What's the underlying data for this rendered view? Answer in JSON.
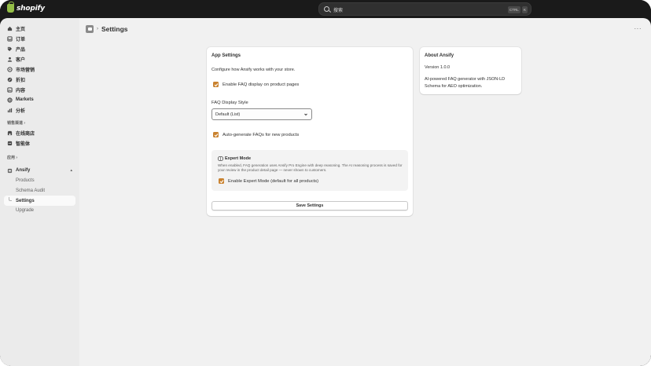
{
  "topbar": {
    "brand": "shopify",
    "search_placeholder": "搜索",
    "shortcut_ctrl": "CTRL",
    "shortcut_k": "K"
  },
  "sidebar": {
    "items": [
      {
        "label": "主页",
        "icon": "home-icon"
      },
      {
        "label": "订单",
        "icon": "inbox-icon"
      },
      {
        "label": "产品",
        "icon": "tag-icon"
      },
      {
        "label": "客户",
        "icon": "person-icon"
      },
      {
        "label": "市场营销",
        "icon": "target-icon"
      },
      {
        "label": "折扣",
        "icon": "discount-icon"
      },
      {
        "label": "内容",
        "icon": "content-icon"
      },
      {
        "label": "Markets",
        "icon": "globe-icon"
      },
      {
        "label": "分析",
        "icon": "chart-icon"
      }
    ],
    "sales_channels_heading": "销售渠道",
    "channels": [
      {
        "label": "在线商店",
        "icon": "store-icon"
      },
      {
        "label": "智能体",
        "icon": "agent-icon"
      }
    ],
    "apps_heading": "应用",
    "app": {
      "label": "Ansify",
      "icon": "app-icon"
    },
    "app_subitems": [
      {
        "label": "Products",
        "active": false
      },
      {
        "label": "Schema Audit",
        "active": false
      },
      {
        "label": "Settings",
        "active": true
      },
      {
        "label": "Upgrade",
        "active": false
      }
    ]
  },
  "header": {
    "title": "Settings",
    "breadcrumb_sep": "›",
    "more": "···"
  },
  "settings_card": {
    "title": "App Settings",
    "description": "Configure how Ansify works with your store.",
    "enable_faq_label": "Enable FAQ display on product pages",
    "enable_faq_checked": true,
    "display_style_label": "FAQ Display Style",
    "display_style_value": "Default (List)",
    "auto_generate_label": "Auto-generate FAQs for new products",
    "auto_generate_checked": true,
    "expert_title": "Expert Mode",
    "expert_desc": "When enabled, FAQ generation uses Ansify Pro Engine with deep reasoning. The AI reasoning process is saved for your review in the product detail page — never shown to customers.",
    "expert_checkbox_label": "Enable Expert Mode (default for all products)",
    "expert_checked": true,
    "save_label": "Save Settings"
  },
  "about_card": {
    "title": "About Ansify",
    "version": "Version 1.0.0",
    "description": "AI-powered FAQ generator with JSON-LD Schema for AEO optimization."
  },
  "colors": {
    "checkbox": "#c9822f",
    "topbar": "#1a1a1a",
    "sidebar": "#ebebeb",
    "canvas": "#f1f1f1"
  }
}
